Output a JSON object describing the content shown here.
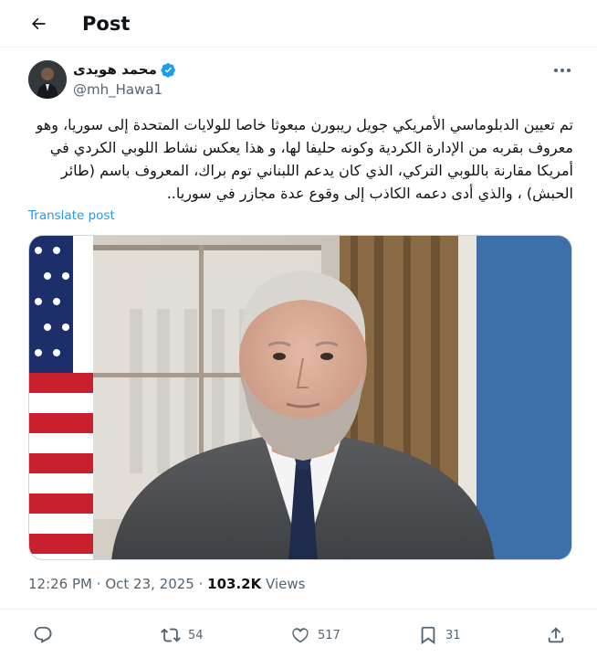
{
  "header": {
    "title": "Post"
  },
  "tweet": {
    "author_name": "محمد هويدى",
    "author_handle": "@mh_Hawa1",
    "text": "تم تعيين الدبلوماسي الأمريكي جويل ريبورن مبعوثا خاصا للولايات المتحدة إلى سوريا، وهو معروف بقربه من الإدارة الكردية وكونه حليفا لها، و هذا يعكس نشاط اللوبي الكردي في أمريكا مقارنة باللوبي التركي، الذي كان يدعم اللبناني توم براك، المعروف باسم (طائر الحبش) ، والذي أدى دعمه الكاذب إلى وقوع عدة مجازر في سوريا..",
    "translate_label": "Translate post",
    "time": "12:26 PM",
    "date": "Oct 23, 2025",
    "separator": "·",
    "views_count": "103.2K",
    "views_label": "Views"
  },
  "actions": {
    "replies": "",
    "reposts": "54",
    "likes": "517",
    "bookmarks": "31"
  },
  "icons": [
    "back-arrow-icon",
    "verified-badge-icon",
    "more-icon",
    "reply-icon",
    "repost-icon",
    "like-icon",
    "bookmark-icon",
    "share-icon"
  ],
  "colors": {
    "accent": "#1d9bf0",
    "text": "#0f1419",
    "secondary": "#536471"
  }
}
